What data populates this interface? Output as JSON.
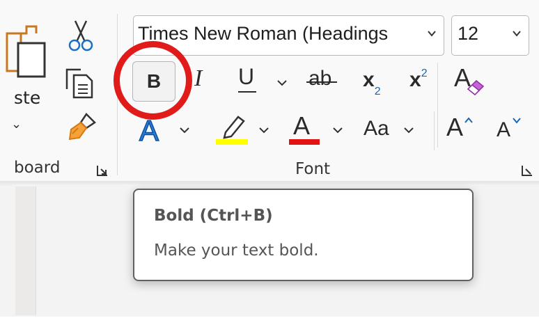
{
  "clipboard": {
    "paste_label": "ste",
    "group_label": "board"
  },
  "font_group": {
    "font_name": "Times New Roman (Headings",
    "font_size": "12",
    "bold_label": "B",
    "italic_label": "I",
    "underline_label": "U",
    "strikethrough_label": "ab",
    "subscript_label": "x",
    "subscript_mark": "2",
    "superscript_label": "x",
    "superscript_mark": "2",
    "font_color_label": "A",
    "change_case_label": "Aa",
    "grow_label": "A",
    "shrink_label": "A",
    "group_label": "Font"
  },
  "tooltip": {
    "title": "Bold (Ctrl+B)",
    "description": "Make your text bold."
  },
  "colors": {
    "highlight_ring": "#e11a1a",
    "font_color_bar": "#e31313",
    "highlighter_bar": "#ffff00",
    "accent_blue": "#1467b8"
  },
  "icons": [
    "paste-icon",
    "cut-icon",
    "copy-icon",
    "format-painter-icon",
    "clear-formatting-icon",
    "text-effects-icon",
    "highlighter-icon",
    "dialog-launcher-icon"
  ]
}
